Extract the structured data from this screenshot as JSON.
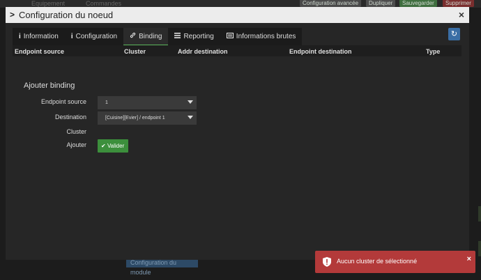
{
  "background": {
    "tabs": [
      "Equipement",
      "Commandes"
    ],
    "buttons": {
      "advanced": "Configuration avancée",
      "duplicate": "Dupliquer",
      "save": "Sauvegarder",
      "delete": "Supprimer"
    },
    "module_config": "Configuration du module"
  },
  "modal": {
    "title": "Configuration du noeud",
    "close": "×",
    "tabs": [
      {
        "label": "Information",
        "icon": "info-icon"
      },
      {
        "label": "Configuration",
        "icon": "info-icon"
      },
      {
        "label": "Binding",
        "icon": "link-icon"
      },
      {
        "label": "Reporting",
        "icon": "list-icon"
      },
      {
        "label": "Informations brutes",
        "icon": "id-card-icon"
      }
    ],
    "active_tab": "Binding",
    "table_headers": [
      "Endpoint source",
      "Cluster",
      "Addr destination",
      "Endpoint destination",
      "Type"
    ],
    "form": {
      "title": "Ajouter binding",
      "endpoint_source_label": "Endpoint source",
      "endpoint_source_value": "1",
      "destination_label": "Destination",
      "destination_value": "[Cuisine][Evier] / endpoint 1",
      "cluster_label": "Cluster",
      "add_label": "Ajouter",
      "validate_button": "Valider"
    }
  },
  "toast": {
    "message": "Aucun cluster de sélectionné",
    "close": "×"
  },
  "colors": {
    "success": "#3c8f3c",
    "danger": "#b33a3a",
    "primary": "#3a6ea5"
  }
}
